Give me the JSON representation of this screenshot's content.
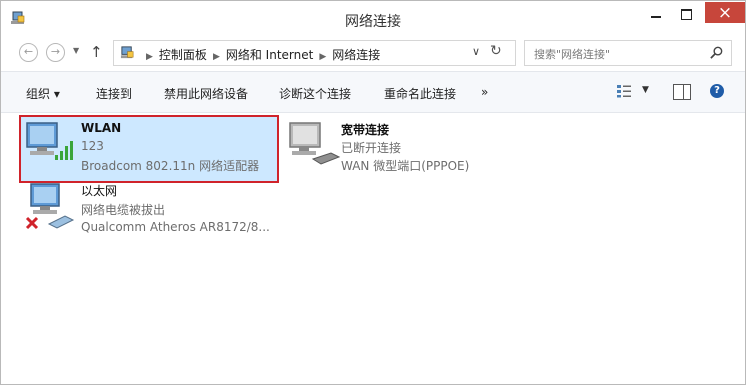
{
  "window": {
    "title": "网络连接",
    "close_glyph": "×"
  },
  "address": {
    "crumbs": [
      "控制面板",
      "网络和 Internet",
      "网络连接"
    ],
    "search_placeholder": "搜索\"网络连接\""
  },
  "toolbar": {
    "organize": "组织 ▾",
    "connect_to": "连接到",
    "disable_device": "禁用此网络设备",
    "diagnose": "诊断这个连接",
    "rename": "重命名此连接",
    "more": "»"
  },
  "connections": [
    {
      "name": "WLAN",
      "status": "123",
      "device": "Broadcom 802.11n 网络适配器",
      "selected": true
    },
    {
      "name": "宽带连接",
      "status": "已断开连接",
      "device": "WAN 微型端口(PPPOE)"
    },
    {
      "name": "以太网",
      "status": "网络电缆被拔出",
      "device": "Qualcomm Atheros AR8172/8..."
    }
  ],
  "colors": {
    "selection_border": "#d0232b",
    "selection_fill": "#cde8ff",
    "close_button": "#c7463b"
  }
}
